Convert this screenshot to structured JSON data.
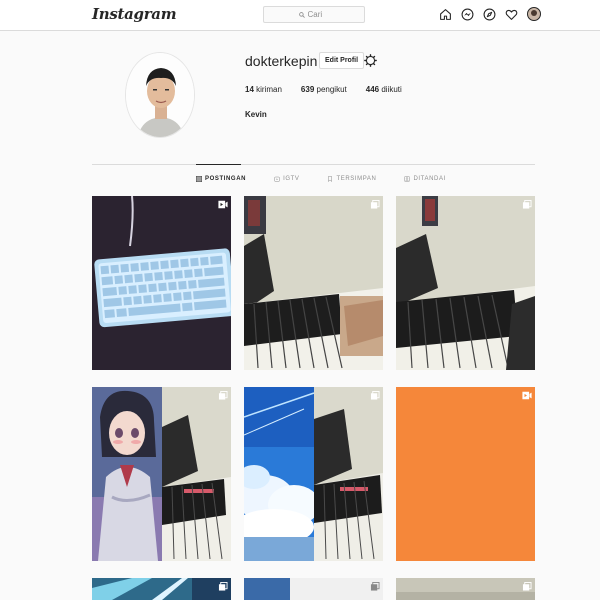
{
  "app": {
    "logo": "Instagram"
  },
  "search": {
    "placeholder": "Cari"
  },
  "nav": {
    "icons": [
      "home-icon",
      "messenger-icon",
      "explore-icon",
      "heart-icon",
      "profile-avatar"
    ]
  },
  "profile": {
    "username": "dokterkepin",
    "edit_label": "Edit Profil",
    "posts_count": "14",
    "posts_label": " kiriman",
    "followers_count": "639",
    "followers_label": " pengikut",
    "following_count": "446",
    "following_label": " diikuti",
    "full_name": "Kevin"
  },
  "tabs": [
    {
      "label": "POSTINGAN",
      "active": true
    },
    {
      "label": "IGTV",
      "active": false
    },
    {
      "label": "TERSIMPAN",
      "active": false
    },
    {
      "label": "DITANDAI",
      "active": false
    }
  ],
  "posts": [
    {
      "desc": "rgb-keyboard",
      "badge": "video-icon"
    },
    {
      "desc": "piano-keys",
      "badge": "multi-icon"
    },
    {
      "desc": "piano-keys",
      "badge": "multi-icon"
    },
    {
      "desc": "anime-girl-piano-collage",
      "badge": "multi-icon"
    },
    {
      "desc": "sky-piano-collage",
      "badge": "multi-icon"
    },
    {
      "desc": "orange-video",
      "badge": "video-icon"
    },
    {
      "desc": "partial-row-1",
      "badge": "multi-icon"
    },
    {
      "desc": "partial-row-2",
      "badge": "multi-icon"
    },
    {
      "desc": "partial-row-3",
      "badge": "multi-icon"
    }
  ],
  "colors": {
    "accent": "#262626",
    "border": "#dbdbdb",
    "orange_tile": "#f5873a",
    "background": "#fafafa"
  }
}
